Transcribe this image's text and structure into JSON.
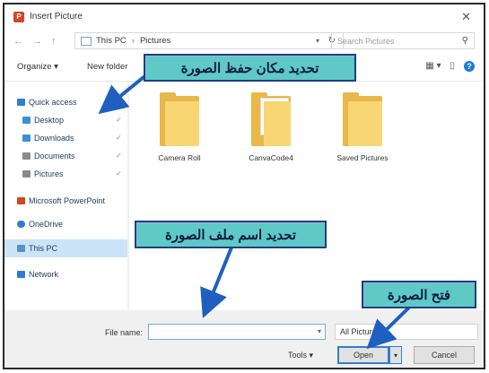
{
  "window": {
    "title": "Insert Picture",
    "close_glyph": "✕"
  },
  "navbar": {
    "back": "←",
    "forward": "→",
    "up": "↑",
    "path": [
      "This PC",
      "Pictures"
    ],
    "refresh_glyph": "↻",
    "search_placeholder": "Search Pictures"
  },
  "commandbar": {
    "organize": "Organize ▾",
    "new_folder": "New folder",
    "view": "▦ ▾",
    "pane": "▯",
    "help": "?"
  },
  "sidebar": {
    "items": [
      {
        "label": "Quick access",
        "color": "#2f7dd3"
      },
      {
        "label": "Desktop",
        "color": "#3d8fd9"
      },
      {
        "label": "Downloads",
        "color": "#3d8fd9"
      },
      {
        "label": "Documents",
        "color": "#8a8a8a"
      },
      {
        "label": "Pictures",
        "color": "#8a8a8a"
      },
      {
        "label": "Microsoft PowerPoint",
        "color": "#d24726"
      },
      {
        "label": "OneDrive",
        "color": "#2f7dd3"
      },
      {
        "label": "This PC",
        "color": "#5b8fc9"
      },
      {
        "label": "Network",
        "color": "#2f7dd3"
      }
    ],
    "pin_glyph": "✓"
  },
  "folders": [
    {
      "label": "Camera Roll"
    },
    {
      "label": "CanvaCode4"
    },
    {
      "label": "Saved Pictures"
    }
  ],
  "bottom": {
    "file_name_label": "File name:",
    "file_name_value": "",
    "filter_value": "All Pictures",
    "tools": "Tools ▾",
    "open": "Open",
    "open_split": "▾",
    "cancel": "Cancel"
  },
  "callouts": {
    "location": "تحديد مكان حفظ الصورة",
    "filename": "تحديد اسم ملف الصورة",
    "open": "فتح الصورة"
  },
  "colors": {
    "callout_fill": "#5fc9c6",
    "callout_border": "#1d3f80",
    "arrow": "#1f5fbf"
  }
}
